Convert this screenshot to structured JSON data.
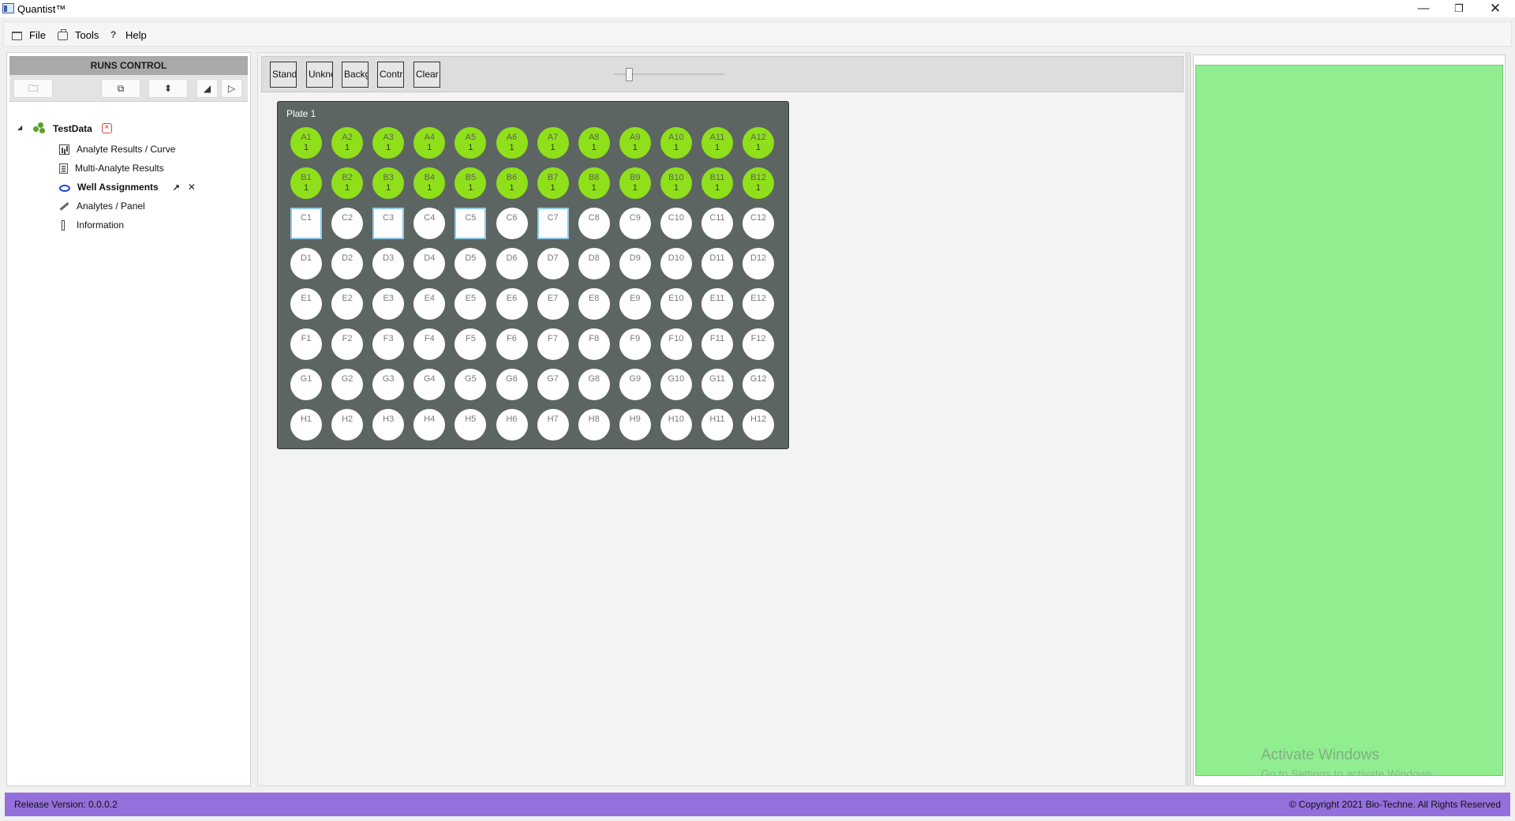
{
  "window": {
    "title": "Quantist™",
    "minimize": "—",
    "restore": "❐",
    "close": "✕"
  },
  "menu": [
    {
      "label": "File",
      "icon": "file-icon"
    },
    {
      "label": "Tools",
      "icon": "tools-icon"
    },
    {
      "label": "Help",
      "icon": "help-icon"
    }
  ],
  "runs_control": {
    "title": "RUNS CONTROL",
    "toolbar": {
      "open_icon": "🗀",
      "copy_icon": "⧉",
      "upload_icon": "⬍",
      "collapse_icon": "◢",
      "play_icon": "▷"
    },
    "tree": {
      "root": "TestData",
      "root_close": "×",
      "items": [
        {
          "label": "Analyte Results / Curve"
        },
        {
          "label": "Multi-Analyte Results"
        },
        {
          "label": "Well Assignments",
          "active": true
        },
        {
          "label": "Analytes / Panel"
        },
        {
          "label": "Information"
        }
      ],
      "pin_icon": "↗",
      "close_icon": "✕"
    }
  },
  "well_toolbar": {
    "buttons": [
      "Stand.",
      "Unknc",
      "Backg",
      "Contrı",
      "Clear"
    ]
  },
  "plate": {
    "title": "Plate  1",
    "rows": [
      [
        "A1",
        "A2",
        "A3",
        "A4",
        "A5",
        "A6",
        "A7",
        "A8",
        "A9",
        "A10",
        "A11",
        "A12"
      ],
      [
        "B1",
        "B2",
        "B3",
        "B4",
        "B5",
        "B6",
        "B7",
        "B8",
        "B9",
        "B10",
        "B11",
        "B12"
      ],
      [
        "C1",
        "C2",
        "C3",
        "C4",
        "C5",
        "C6",
        "C7",
        "C8",
        "C9",
        "C10",
        "C11",
        "C12"
      ],
      [
        "D1",
        "D2",
        "D3",
        "D4",
        "D5",
        "D6",
        "D7",
        "D8",
        "D9",
        "D10",
        "D11",
        "D12"
      ],
      [
        "E1",
        "E2",
        "E3",
        "E4",
        "E5",
        "E6",
        "E7",
        "E8",
        "E9",
        "E10",
        "E11",
        "E12"
      ],
      [
        "F1",
        "F2",
        "F3",
        "F4",
        "F5",
        "F6",
        "F7",
        "F8",
        "F9",
        "F10",
        "F11",
        "F12"
      ],
      [
        "G1",
        "G2",
        "G3",
        "G4",
        "G5",
        "G6",
        "G7",
        "G8",
        "G9",
        "G10",
        "G11",
        "G12"
      ],
      [
        "H1",
        "H2",
        "H3",
        "H4",
        "H5",
        "H6",
        "H7",
        "H8",
        "H9",
        "H10",
        "H11",
        "H12"
      ]
    ],
    "assigned_rows": [
      "A",
      "B"
    ],
    "assigned_value": "1",
    "selected_wells": [
      "C1",
      "C3",
      "C5",
      "C7"
    ],
    "colors": {
      "assigned": "#8fe01a",
      "empty": "#ffffff",
      "plate": "#5d6562",
      "selection": "#8ecae6"
    }
  },
  "right_panel": {
    "color": "#90ee90"
  },
  "watermark": {
    "title": "Activate Windows",
    "subtitle": "Go to Settings to activate Windows."
  },
  "status": {
    "version": "Release Version: 0.0.0.2",
    "copyright": "© Copyright 2021 Bio-Techne. All Rights Reserved",
    "color": "#9370db"
  }
}
